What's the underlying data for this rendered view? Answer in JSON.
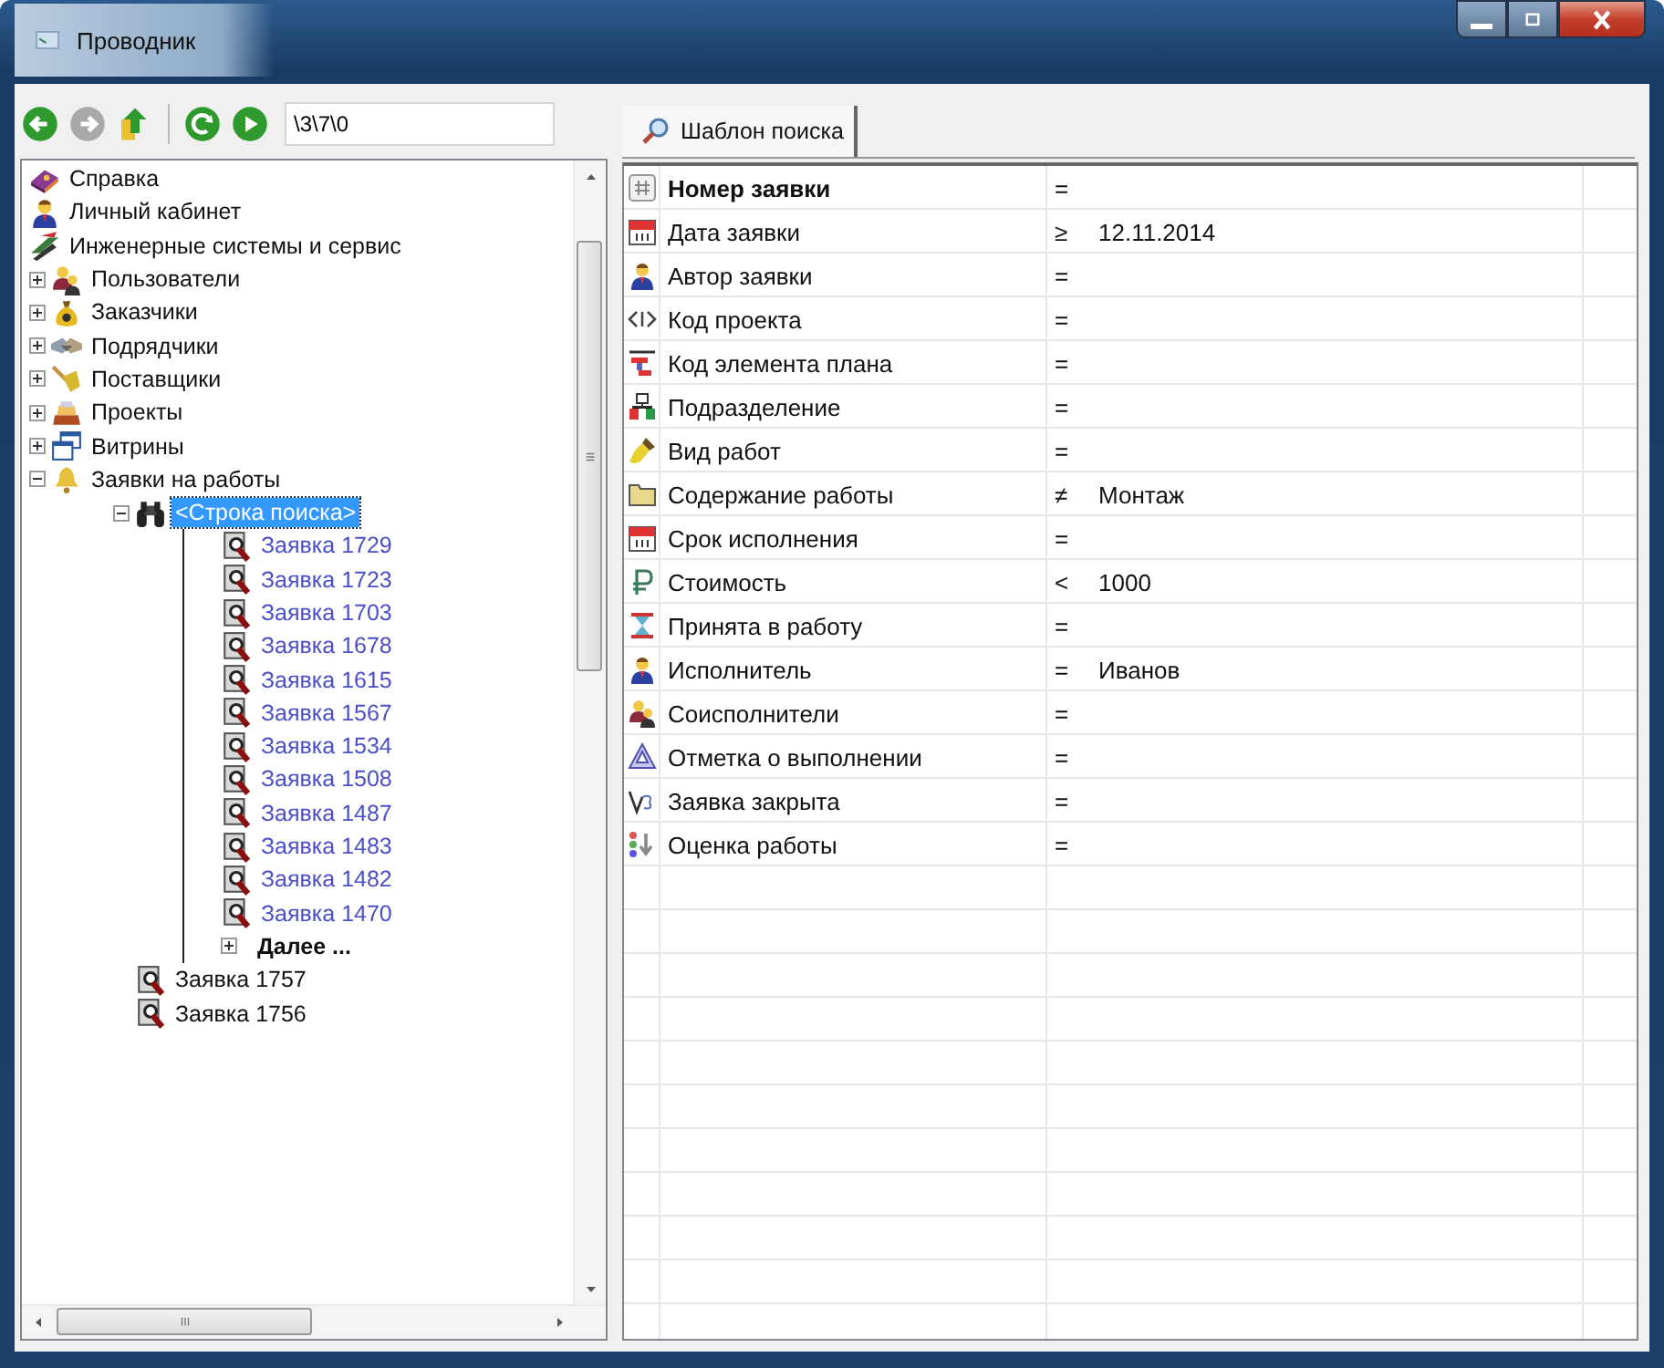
{
  "window": {
    "title": "Проводник"
  },
  "toolbar": {
    "buttons": [
      {
        "disabled": false
      },
      {
        "disabled": true
      },
      {
        "disabled": false
      },
      {
        "disabled": false
      },
      {
        "disabled": false
      }
    ],
    "path": "\\3\\7\\0"
  },
  "tree": {
    "items": [
      {
        "label": "Справка",
        "kind": "node"
      },
      {
        "label": "Личный кабинет",
        "kind": "node"
      },
      {
        "label": "Инженерные системы и сервис",
        "kind": "node",
        "children": [
          {
            "label": "Пользователи",
            "kind": "node",
            "expanded": false
          },
          {
            "label": "Заказчики",
            "kind": "node",
            "expanded": false
          },
          {
            "label": "Подрядчики",
            "kind": "node",
            "expanded": false
          },
          {
            "label": "Поставщики",
            "kind": "node",
            "expanded": false
          },
          {
            "label": "Проекты",
            "kind": "node",
            "expanded": false
          },
          {
            "label": "Витрины",
            "kind": "node",
            "expanded": false
          },
          {
            "label": "Заявки на работы",
            "kind": "node",
            "expanded": true,
            "children": [
              {
                "label": "<Строка поиска>",
                "kind": "search",
                "expanded": true,
                "selected": true,
                "children": [
                  {
                    "label": "Заявка 1729",
                    "kind": "result",
                    "selected": false
                  },
                  {
                    "label": "Заявка 1723",
                    "kind": "result",
                    "selected": false
                  },
                  {
                    "label": "Заявка 1703",
                    "kind": "result",
                    "selected": false
                  },
                  {
                    "label": "Заявка 1678",
                    "kind": "result",
                    "selected": false
                  },
                  {
                    "label": "Заявка 1615",
                    "kind": "result",
                    "selected": false
                  },
                  {
                    "label": "Заявка 1567",
                    "kind": "result",
                    "selected": false
                  },
                  {
                    "label": "Заявка 1534",
                    "kind": "result",
                    "selected": false
                  },
                  {
                    "label": "Заявка 1508",
                    "kind": "result",
                    "selected": false
                  },
                  {
                    "label": "Заявка 1487",
                    "kind": "result",
                    "selected": false
                  },
                  {
                    "label": "Заявка 1483",
                    "kind": "result",
                    "selected": false
                  },
                  {
                    "label": "Заявка 1482",
                    "kind": "result",
                    "selected": false
                  },
                  {
                    "label": "Заявка 1470",
                    "kind": "result",
                    "selected": false
                  },
                  {
                    "label": "Далее ...",
                    "kind": "more",
                    "expanded": false
                  }
                ]
              },
              {
                "label": "Заявка 1757",
                "kind": "request",
                "selected": false
              },
              {
                "label": "Заявка 1756",
                "kind": "request",
                "selected": false
              }
            ]
          }
        ]
      }
    ]
  },
  "tabs": [
    {
      "label": "Шаблон поиска",
      "selected": true
    }
  ],
  "grid": {
    "rows": [
      {
        "label": "Номер заявки",
        "bold": true,
        "op": "=",
        "value": ""
      },
      {
        "label": "Дата заявки",
        "bold": false,
        "op": "≥",
        "value": "12.11.2014"
      },
      {
        "label": "Автор заявки",
        "bold": false,
        "op": "=",
        "value": ""
      },
      {
        "label": "Код проекта",
        "bold": false,
        "op": "=",
        "value": ""
      },
      {
        "label": "Код элемента плана",
        "bold": false,
        "op": "=",
        "value": ""
      },
      {
        "label": "Подразделение",
        "bold": false,
        "op": "=",
        "value": ""
      },
      {
        "label": "Вид работ",
        "bold": false,
        "op": "=",
        "value": ""
      },
      {
        "label": "Содержание работы",
        "bold": false,
        "op": "≠",
        "value": "Монтаж"
      },
      {
        "label": "Срок исполнения",
        "bold": false,
        "op": "=",
        "value": ""
      },
      {
        "label": "Стоимость",
        "bold": false,
        "op": "<",
        "value": "1000"
      },
      {
        "label": "Принята в работу",
        "bold": false,
        "op": "=",
        "value": ""
      },
      {
        "label": "Исполнитель",
        "bold": false,
        "op": "=",
        "value": "Иванов"
      },
      {
        "label": "Соисполнители",
        "bold": false,
        "op": "=",
        "value": ""
      },
      {
        "label": "Отметка о выполнении",
        "bold": false,
        "op": "=",
        "value": ""
      },
      {
        "label": "Заявка закрыта",
        "bold": false,
        "op": "=",
        "value": ""
      },
      {
        "label": "Оценка работы",
        "bold": false,
        "op": "=",
        "value": ""
      }
    ]
  }
}
